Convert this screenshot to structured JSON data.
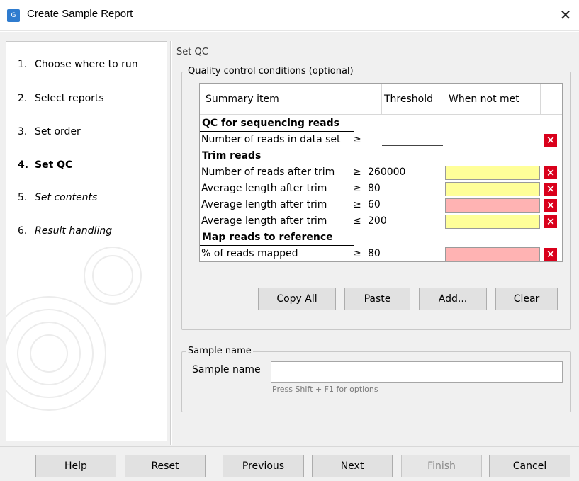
{
  "window": {
    "title": "Create Sample Report",
    "app_icon_glyph": "G"
  },
  "steps": [
    {
      "num": "1.",
      "label": "Choose where to run",
      "style": "normal"
    },
    {
      "num": "2.",
      "label": "Select reports",
      "style": "normal"
    },
    {
      "num": "3.",
      "label": "Set order",
      "style": "normal"
    },
    {
      "num": "4.",
      "label": "Set QC",
      "style": "bold"
    },
    {
      "num": "5.",
      "label": "Set contents",
      "style": "italic"
    },
    {
      "num": "6.",
      "label": "Result handling",
      "style": "italic"
    }
  ],
  "main": {
    "section_title": "Set QC",
    "qc_group_title": "Quality control conditions (optional)",
    "table": {
      "headers": {
        "summary_item": "Summary item",
        "threshold": "Threshold",
        "when_not_met": "When not met"
      },
      "rows": [
        {
          "type": "group",
          "name": "QC for sequencing reads"
        },
        {
          "type": "item",
          "name": "Number of reads in data set",
          "op": "≥",
          "threshold": "",
          "color": "none"
        },
        {
          "type": "group",
          "name": "Trim reads"
        },
        {
          "type": "item",
          "name": "Number of reads after trim",
          "op": "≥",
          "threshold": "260000",
          "color": "#ffff99"
        },
        {
          "type": "item",
          "name": "Average length after trim",
          "op": "≥",
          "threshold": "80",
          "color": "#ffff99"
        },
        {
          "type": "item",
          "name": "Average length after trim",
          "op": "≥",
          "threshold": "60",
          "color": "#ffb3b3"
        },
        {
          "type": "item",
          "name": "Average length after trim",
          "op": "≤",
          "threshold": "200",
          "color": "#ffff99"
        },
        {
          "type": "group",
          "name": "Map reads to reference"
        },
        {
          "type": "item",
          "name": "% of reads mapped",
          "op": "≥",
          "threshold": "80",
          "color": "#ffb3b3"
        }
      ],
      "delete_glyph": "✕"
    },
    "buttons": {
      "copy_all": "Copy All",
      "paste": "Paste",
      "add": "Add...",
      "clear": "Clear"
    },
    "sample_group_title": "Sample name",
    "sample_label": "Sample name",
    "sample_value": "",
    "sample_hint": "Press Shift + F1 for options"
  },
  "footer": {
    "help": "Help",
    "reset": "Reset",
    "previous": "Previous",
    "next": "Next",
    "finish": "Finish",
    "cancel": "Cancel"
  },
  "colors": {
    "warning_yellow": "#ffff99",
    "error_pink": "#ffb3b3",
    "delete_red": "#d9001b",
    "app_icon_blue": "#2f7ccf"
  },
  "icons": {
    "app": "clc-workbench-icon",
    "close": "close-icon",
    "delete": "delete-icon"
  }
}
